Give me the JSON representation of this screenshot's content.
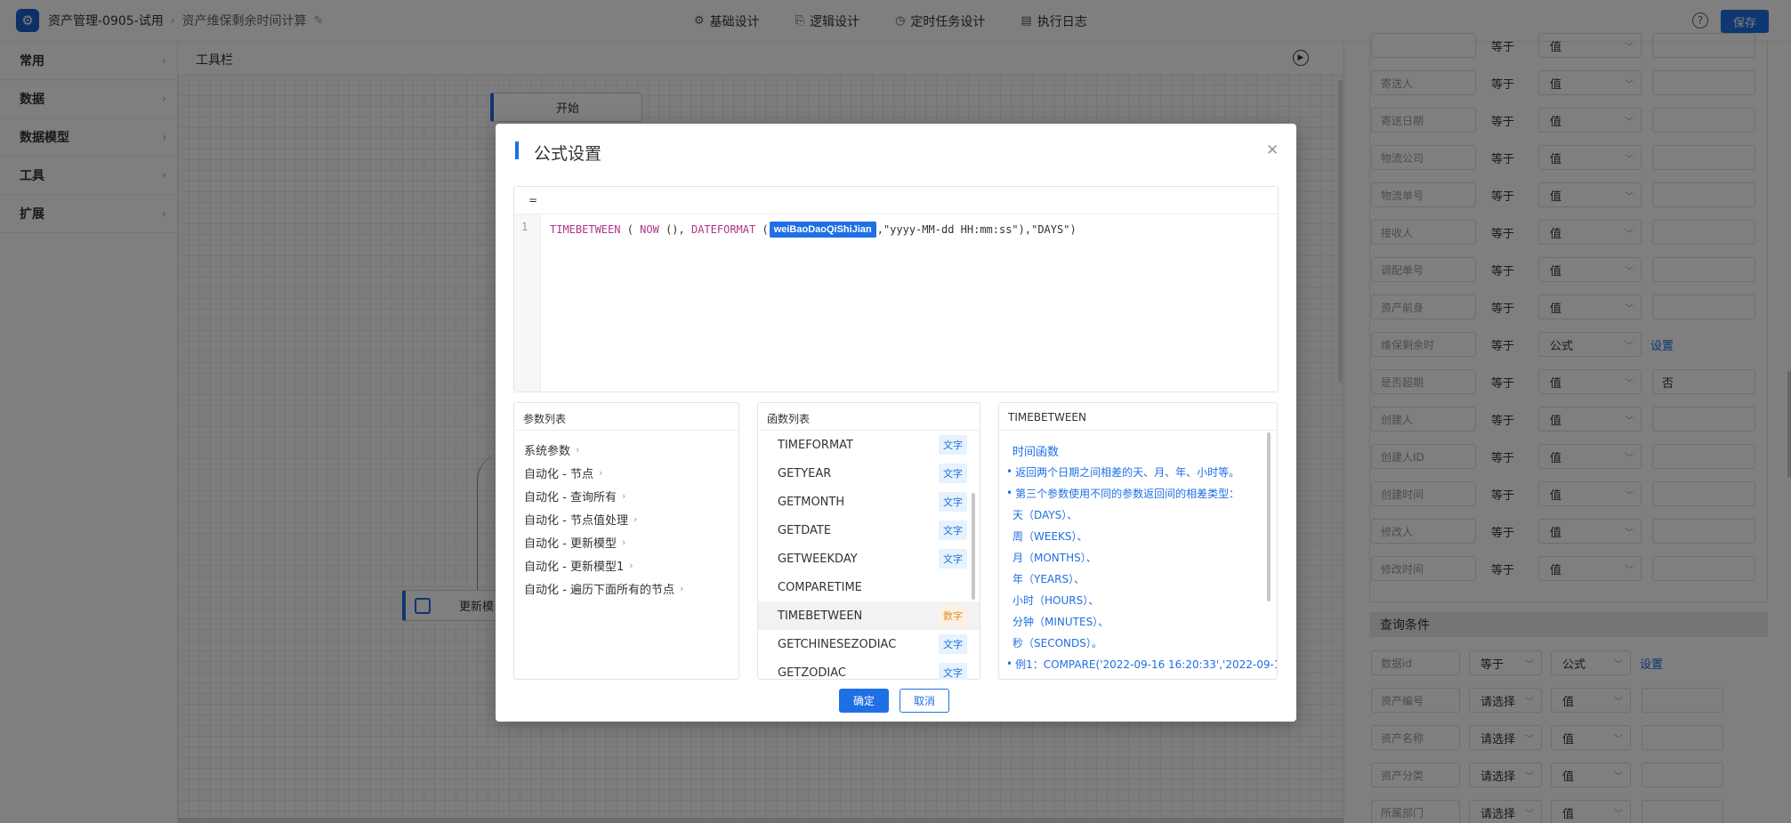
{
  "header": {
    "app_name": "资产管理-0905-试用",
    "page_name": "资产维保剩余时间计算",
    "tabs": [
      {
        "label": "基础设计",
        "icon": "gear-icon"
      },
      {
        "label": "逻辑设计",
        "icon": "logic-icon"
      },
      {
        "label": "定时任务设计",
        "icon": "clock-icon"
      },
      {
        "label": "执行日志",
        "icon": "document-icon"
      }
    ],
    "save_label": "保存"
  },
  "sidebar": {
    "items": [
      {
        "label": "常用"
      },
      {
        "label": "数据"
      },
      {
        "label": "数据模型"
      },
      {
        "label": "工具"
      },
      {
        "label": "扩展"
      }
    ]
  },
  "canvas": {
    "toolbar_label": "工具栏",
    "start_node": "开始",
    "update_node": "更新模"
  },
  "right_panel": {
    "rows": [
      {
        "field": "",
        "op": "等于",
        "select": "值",
        "value": "",
        "link": ""
      },
      {
        "field": "寄送人",
        "op": "等于",
        "select": "值",
        "value": "",
        "link": ""
      },
      {
        "field": "寄送日期",
        "op": "等于",
        "select": "值",
        "value": "",
        "link": ""
      },
      {
        "field": "物流公司",
        "op": "等于",
        "select": "值",
        "value": "",
        "link": ""
      },
      {
        "field": "物流单号",
        "op": "等于",
        "select": "值",
        "value": "",
        "link": ""
      },
      {
        "field": "接收人",
        "op": "等于",
        "select": "值",
        "value": "",
        "link": ""
      },
      {
        "field": "调配单号",
        "op": "等于",
        "select": "值",
        "value": "",
        "link": ""
      },
      {
        "field": "资产前身",
        "op": "等于",
        "select": "值",
        "value": "",
        "link": ""
      },
      {
        "field": "维保剩余时",
        "op": "等于",
        "select": "公式",
        "value": "",
        "link": "设置"
      },
      {
        "field": "是否超期",
        "op": "等于",
        "select": "值",
        "value": "否",
        "link": ""
      },
      {
        "field": "创建人",
        "op": "等于",
        "select": "值",
        "value": "",
        "link": ""
      },
      {
        "field": "创建人ID",
        "op": "等于",
        "select": "值",
        "value": "",
        "link": ""
      },
      {
        "field": "创建时间",
        "op": "等于",
        "select": "值",
        "value": "",
        "link": ""
      },
      {
        "field": "修改人",
        "op": "等于",
        "select": "值",
        "value": "",
        "link": ""
      },
      {
        "field": "修改时间",
        "op": "等于",
        "select": "值",
        "value": "",
        "link": ""
      }
    ],
    "query_header": "查询条件",
    "query_rows": [
      {
        "field": "数据id",
        "op": "等于",
        "select": "公式",
        "link": "设置"
      },
      {
        "field": "资产编号",
        "op": "请选择",
        "select": "值",
        "link": ""
      },
      {
        "field": "资产名称",
        "op": "请选择",
        "select": "值",
        "link": ""
      },
      {
        "field": "资产分类",
        "op": "请选择",
        "select": "值",
        "link": ""
      },
      {
        "field": "所属部门",
        "op": "请选择",
        "select": "值",
        "link": ""
      }
    ]
  },
  "modal": {
    "title": "公式设置",
    "eq_sign": "=",
    "line_number": "1",
    "code": {
      "fn1": "TIMEBETWEEN",
      "p1": " ( ",
      "fn2": "NOW",
      "p2": " (), ",
      "fn3": "DATEFORMAT",
      "p3": " (",
      "param": "weiBaoDaoQiShiJian",
      "p4": ",\"yyyy-MM-dd HH:mm:ss\"),\"DAYS\")"
    },
    "param_panel": {
      "title": "参数列表",
      "items": [
        "系统参数",
        "自动化 - 节点",
        "自动化 - 查询所有",
        "自动化 - 节点值处理",
        "自动化 - 更新模型",
        "自动化 - 更新模型1",
        "自动化 - 遍历下面所有的节点"
      ]
    },
    "func_panel": {
      "title": "函数列表",
      "items": [
        {
          "name": "TIMEFORMAT",
          "tag": "文字",
          "kind": "text"
        },
        {
          "name": "GETYEAR",
          "tag": "文字",
          "kind": "text"
        },
        {
          "name": "GETMONTH",
          "tag": "文字",
          "kind": "text"
        },
        {
          "name": "GETDATE",
          "tag": "文字",
          "kind": "text"
        },
        {
          "name": "GETWEEKDAY",
          "tag": "文字",
          "kind": "text"
        },
        {
          "name": "COMPARETIME",
          "tag": "",
          "kind": "none"
        },
        {
          "name": "TIMEBETWEEN",
          "tag": "数字",
          "kind": "num",
          "active": true
        },
        {
          "name": "GETCHINESEZODIAC",
          "tag": "文字",
          "kind": "text"
        },
        {
          "name": "GETZODIAC",
          "tag": "文字",
          "kind": "text"
        }
      ]
    },
    "desc_panel": {
      "title": "TIMEBETWEEN",
      "heading": "时间函数",
      "lines": [
        {
          "text": "返回两个日期之间相差的天、月、年、小时等。",
          "bullet": true
        },
        {
          "text": "第三个参数使用不同的参数返回间的相差类型：",
          "bullet": true
        },
        {
          "text": "天（DAYS）、",
          "bullet": false
        },
        {
          "text": "周（WEEKS）、",
          "bullet": false
        },
        {
          "text": "月（MONTHS）、",
          "bullet": false
        },
        {
          "text": "年（YEARS）、",
          "bullet": false
        },
        {
          "text": "小时（HOURS）、",
          "bullet": false
        },
        {
          "text": "分钟（MINUTES）、",
          "bullet": false
        },
        {
          "text": "秒（SECONDS）。",
          "bullet": false
        },
        {
          "text": "例1：COMPARE('2022-09-16 16:20:33','2022-09-1",
          "bullet": true
        }
      ]
    },
    "ok_label": "确定",
    "cancel_label": "取消",
    "close_icon": "close-icon"
  },
  "colors": {
    "accent": "#1f6fe5",
    "function_name": "#b0348a",
    "number_tag": "#e48b1f"
  }
}
